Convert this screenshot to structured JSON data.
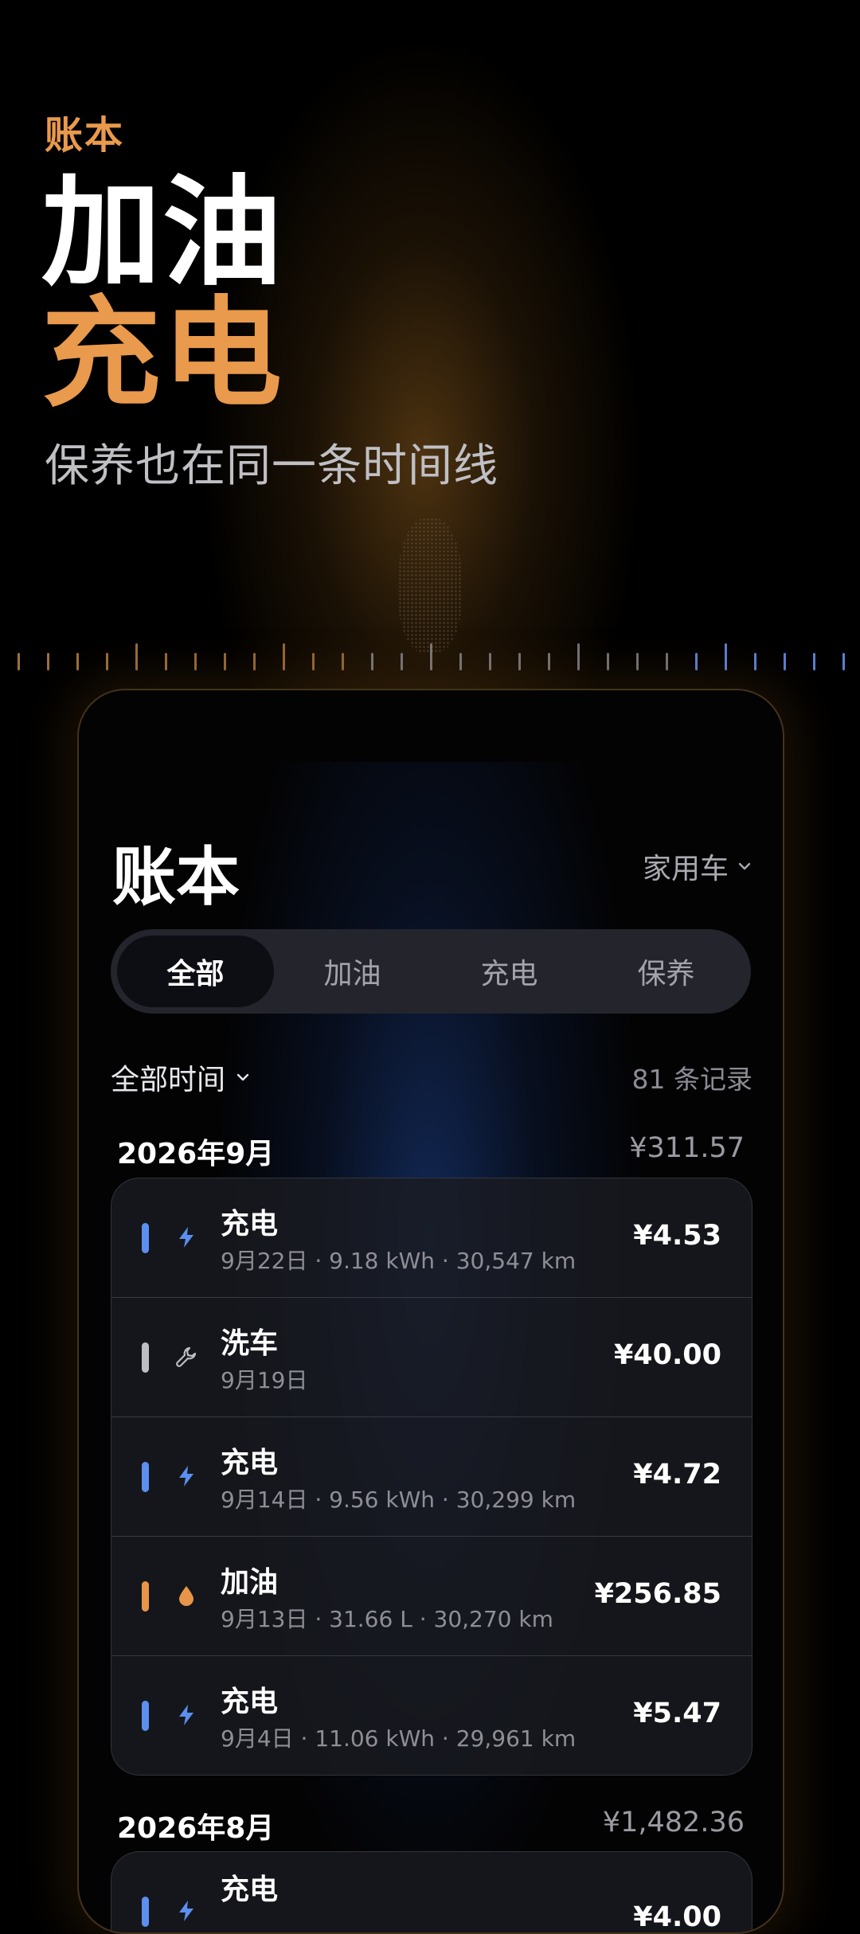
{
  "hero": {
    "eyebrow": "账本",
    "title_line1": "加油",
    "title_line2": "充电",
    "subtitle": "保养也在同一条时间线"
  },
  "colors": {
    "accent_orange": "#e99a4c",
    "charge_blue": "#5b8ff0",
    "fuel_orange": "#e8954a",
    "service_gray": "#bdbdc4"
  },
  "app": {
    "title": "账本",
    "vehicle": "家用车",
    "tabs": [
      {
        "label": "全部",
        "active": true
      },
      {
        "label": "加油",
        "active": false
      },
      {
        "label": "充电",
        "active": false
      },
      {
        "label": "保养",
        "active": false
      }
    ],
    "time_filter": "全部时间",
    "record_count": "81 条记录"
  },
  "months": [
    {
      "label": "2026年9月",
      "total": "¥311.57",
      "entries": [
        {
          "type": "charge",
          "icon": "lightning-icon",
          "name": "充电",
          "detail": "9月22日 · 9.18 kWh · 30,547 km",
          "amount": "¥4.53"
        },
        {
          "type": "service",
          "icon": "wrench-icon",
          "name": "洗车",
          "detail": "9月19日",
          "amount": "¥40.00"
        },
        {
          "type": "charge",
          "icon": "lightning-icon",
          "name": "充电",
          "detail": "9月14日 · 9.56 kWh · 30,299 km",
          "amount": "¥4.72"
        },
        {
          "type": "fuel",
          "icon": "droplet-icon",
          "name": "加油",
          "detail": "9月13日 · 31.66 L · 30,270 km",
          "amount": "¥256.85"
        },
        {
          "type": "charge",
          "icon": "lightning-icon",
          "name": "充电",
          "detail": "9月4日 · 11.06 kWh · 29,961 km",
          "amount": "¥5.47"
        }
      ]
    },
    {
      "label": "2026年8月",
      "total": "¥1,482.36",
      "entries": [
        {
          "type": "charge",
          "icon": "lightning-icon",
          "name": "充电",
          "detail": "",
          "amount": "¥4.00"
        }
      ]
    }
  ]
}
